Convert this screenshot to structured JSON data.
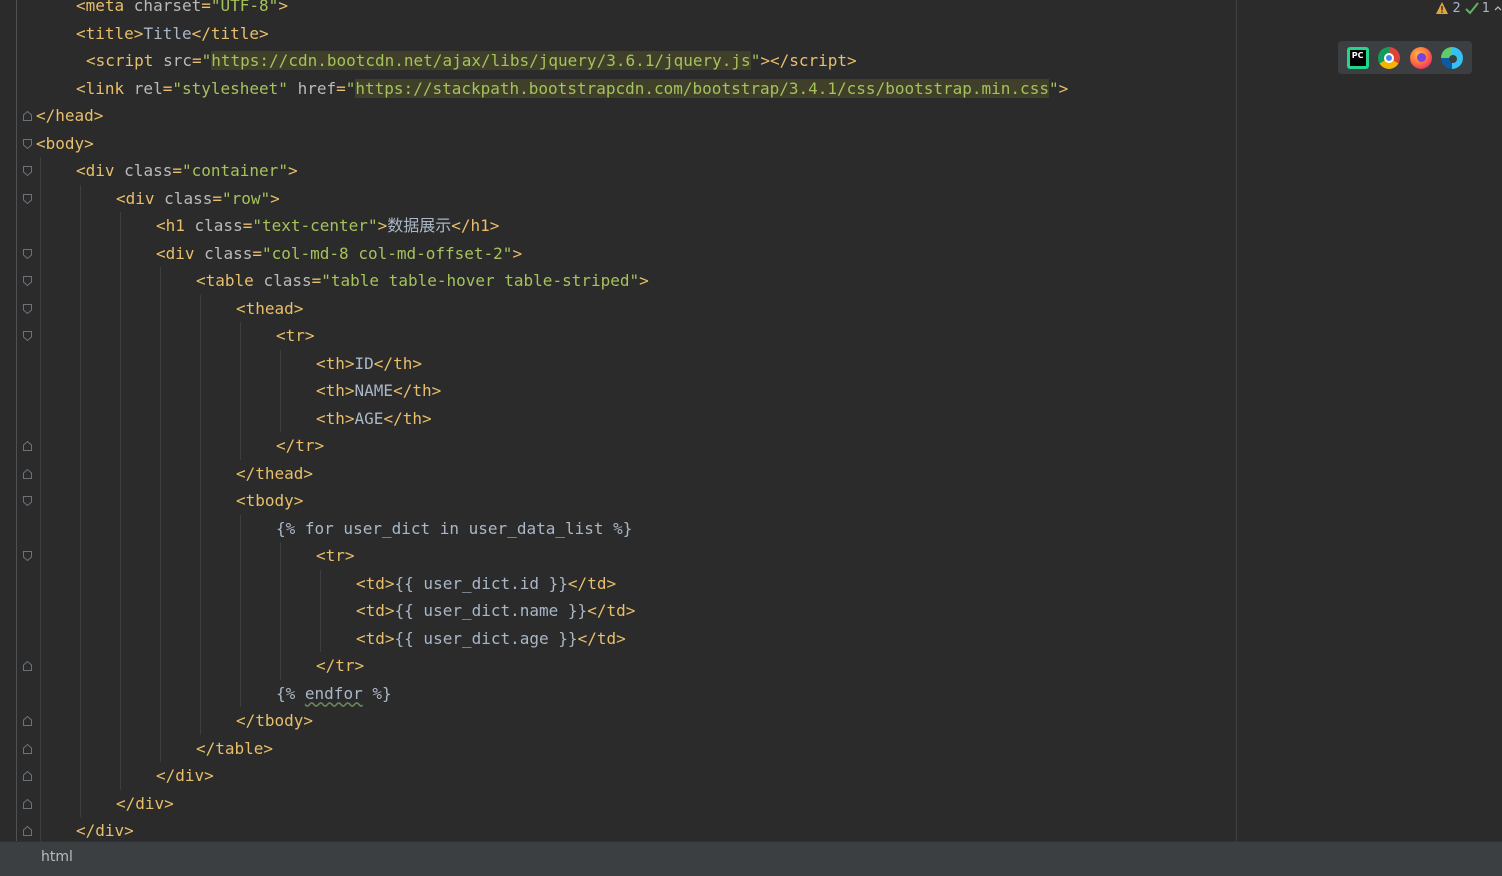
{
  "editor": {
    "lines": [
      {
        "indent": 1,
        "html": "<span class='tag'>&lt;meta </span><span class='attr'>charset</span><span class='tag'>=</span><span class='str'>\"UTF-8\"</span><span class='tag'>&gt;</span>"
      },
      {
        "indent": 1,
        "html": "<span class='tag'>&lt;title&gt;</span><span class='txt'>Title</span><span class='tag'>&lt;/title&gt;</span>"
      },
      {
        "indent": 1,
        "pad": 10,
        "html": "<span class='tag'>&lt;script </span><span class='attr'>src</span><span class='tag'>=</span><span class='str'>\"</span><span class='url'>https://cdn.bootcdn.net/ajax/libs/jquery/3.6.1/jquery.js</span><span class='str'>\"</span><span class='tag'>&gt;&lt;/script&gt;</span>"
      },
      {
        "indent": 1,
        "html": "<span class='tag'>&lt;link </span><span class='attr'>rel</span><span class='tag'>=</span><span class='str'>\"stylesheet\" </span><span class='attr'>href</span><span class='tag'>=</span><span class='str'>\"</span><span class='url'>https://stackpath.bootstrapcdn.com/bootstrap/3.4.1/css/bootstrap.min.css</span><span class='str'>\"</span><span class='tag'>&gt;</span>"
      },
      {
        "indent": 0,
        "html": "<span class='tag'>&lt;/head&gt;</span>"
      },
      {
        "indent": 0,
        "html": "<span class='tag'>&lt;body&gt;</span>"
      },
      {
        "indent": 1,
        "html": "<span class='tag'>&lt;div </span><span class='attr'>class</span><span class='tag'>=</span><span class='str'>\"container\"</span><span class='tag'>&gt;</span>"
      },
      {
        "indent": 2,
        "html": "<span class='tag'>&lt;div </span><span class='attr'>class</span><span class='tag'>=</span><span class='str'>\"row\"</span><span class='tag'>&gt;</span>"
      },
      {
        "indent": 3,
        "html": "<span class='tag'>&lt;h1 </span><span class='attr'>class</span><span class='tag'>=</span><span class='str'>\"text-center\"</span><span class='tag'>&gt;</span><span class='txt'>数据展示</span><span class='tag'>&lt;/h1&gt;</span>"
      },
      {
        "indent": 3,
        "html": "<span class='tag'>&lt;div </span><span class='attr'>class</span><span class='tag'>=</span><span class='str'>\"col-md-8 col-md-offset-2\"</span><span class='tag'>&gt;</span>"
      },
      {
        "indent": 4,
        "html": "<span class='tag'>&lt;table </span><span class='attr'>class</span><span class='tag'>=</span><span class='str'>\"table table-hover table-striped\"</span><span class='tag'>&gt;</span>"
      },
      {
        "indent": 5,
        "html": "<span class='tag'>&lt;thead&gt;</span>"
      },
      {
        "indent": 6,
        "html": "<span class='tag'>&lt;tr&gt;</span>"
      },
      {
        "indent": 7,
        "html": "<span class='tag'>&lt;th&gt;</span><span class='txt'>ID</span><span class='tag'>&lt;/th&gt;</span>"
      },
      {
        "indent": 7,
        "html": "<span class='tag'>&lt;th&gt;</span><span class='txt'>NAME</span><span class='tag'>&lt;/th&gt;</span>"
      },
      {
        "indent": 7,
        "html": "<span class='tag'>&lt;th&gt;</span><span class='txt'>AGE</span><span class='tag'>&lt;/th&gt;</span>"
      },
      {
        "indent": 6,
        "html": "<span class='tag'>&lt;/tr&gt;</span>"
      },
      {
        "indent": 5,
        "html": "<span class='tag'>&lt;/thead&gt;</span>"
      },
      {
        "indent": 5,
        "html": "<span class='tag'>&lt;tbody&gt;</span>"
      },
      {
        "indent": 6,
        "html": "<span class='tpl'>{% for user_dict in user_data_list %}</span>"
      },
      {
        "indent": 7,
        "html": "<span class='tag'>&lt;tr&gt;</span>"
      },
      {
        "indent": 8,
        "html": "<span class='tag'>&lt;td&gt;</span><span class='tpl'>{{ user_dict.id }}</span><span class='tag'>&lt;/td&gt;</span>"
      },
      {
        "indent": 8,
        "html": "<span class='tag'>&lt;td&gt;</span><span class='tpl'>{{ user_dict.name }}</span><span class='tag'>&lt;/td&gt;</span>"
      },
      {
        "indent": 8,
        "html": "<span class='tag'>&lt;td&gt;</span><span class='tpl'>{{ user_dict.age }}</span><span class='tag'>&lt;/td&gt;</span>"
      },
      {
        "indent": 7,
        "html": "<span class='tag'>&lt;/tr&gt;</span>"
      },
      {
        "indent": 6,
        "html": "<span class='tpl'>{% <span class='squiggle'>endfor</span> %}</span>"
      },
      {
        "indent": 5,
        "html": "<span class='tag'>&lt;/tbody&gt;</span>"
      },
      {
        "indent": 4,
        "html": "<span class='tag'>&lt;/table&gt;</span>"
      },
      {
        "indent": 3,
        "html": "<span class='tag'>&lt;/div&gt;</span>"
      },
      {
        "indent": 2,
        "html": "<span class='tag'>&lt;/div&gt;</span>"
      },
      {
        "indent": 1,
        "html": "<span class='tag'>&lt;/div&gt;</span>"
      }
    ]
  },
  "inspection": {
    "warnings": "2",
    "ok": "1"
  },
  "browsers": [
    "pycharm-icon",
    "chrome-icon",
    "firefox-icon",
    "edge-icon"
  ],
  "status_bar": {
    "breadcrumb": "html"
  },
  "colors": {
    "background": "#2b2b2b",
    "tag": "#e8bf6a",
    "string": "#a5c25c",
    "attribute": "#bababa"
  }
}
